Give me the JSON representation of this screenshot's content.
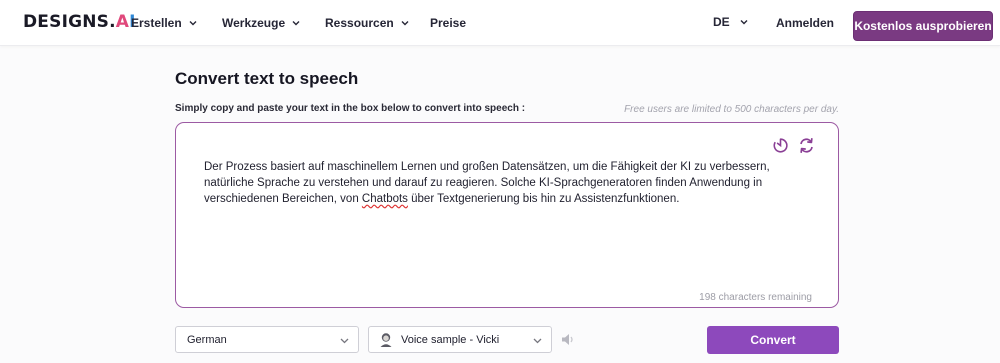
{
  "brand": {
    "logo_text": "DESIGNS.",
    "logo_suffix_a": "A",
    "logo_suffix_i": "I"
  },
  "nav": {
    "items": [
      {
        "label": "Erstellen",
        "has_dropdown": true
      },
      {
        "label": "Werkzeuge",
        "has_dropdown": true
      },
      {
        "label": "Ressourcen",
        "has_dropdown": true
      },
      {
        "label": "Preise",
        "has_dropdown": false
      }
    ],
    "language": "DE",
    "login": "Anmelden",
    "cta": "Kostenlos ausprobieren"
  },
  "main": {
    "title": "Convert text to speech",
    "instruction": "Simply copy and paste your text in the box below to convert into speech :",
    "limit_note": "Free users are limited to 500 characters per day.",
    "text_before": "Der Prozess basiert auf maschinellem Lernen und großen Datensätzen, um die Fähigkeit der KI zu verbessern, natürliche Sprache zu verstehen und darauf zu reagieren. Solche KI-Sprachgeneratoren finden Anwendung in verschiedenen Bereichen, von ",
    "text_misspelled": "Chatbots",
    "text_after": " über Textgenerierung bis hin zu Assistenzfunktionen.",
    "remaining": "198 characters remaining"
  },
  "controls": {
    "language_value": "German",
    "voice_value": "Voice sample - Vicki",
    "convert_label": "Convert"
  },
  "icons": {
    "history": "history-timer-icon",
    "reset": "refresh-icon",
    "speaker": "speaker-icon",
    "avatar": "female-avatar-icon",
    "chevron": "chevron-down-icon"
  },
  "colors": {
    "cta_bg": "#7a3a82",
    "convert_bg": "#8d49bc",
    "textbox_border": "#9c5aa3",
    "accent_icon": "#8a3f95"
  }
}
